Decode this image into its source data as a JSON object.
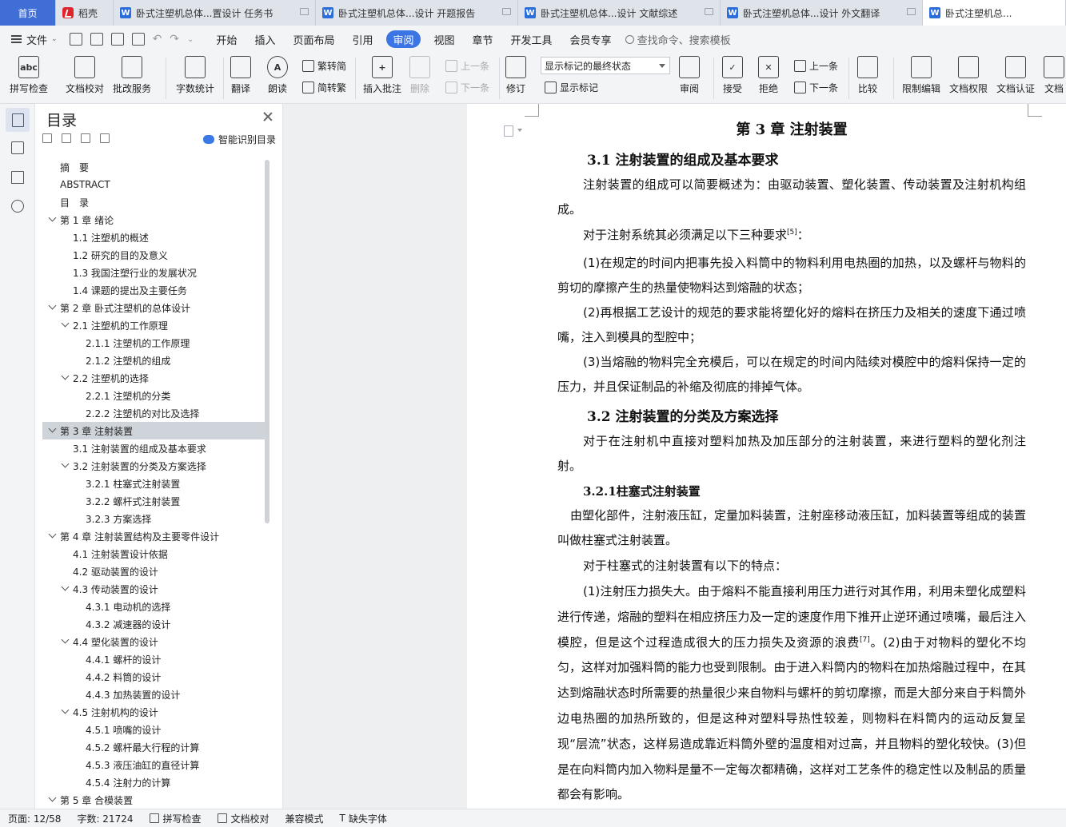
{
  "tabs": [
    {
      "label": "首页",
      "type": "home"
    },
    {
      "label": "稻壳",
      "type": "docer"
    },
    {
      "label": "卧式注塑机总体...置设计 任务书",
      "type": "doc"
    },
    {
      "label": "卧式注塑机总体...设计 开题报告",
      "type": "doc"
    },
    {
      "label": "卧式注塑机总体...设计 文献综述",
      "type": "doc"
    },
    {
      "label": "卧式注塑机总体...设计 外文翻译",
      "type": "doc"
    },
    {
      "label": "卧式注塑机总...",
      "type": "doc",
      "active": true
    }
  ],
  "menu": {
    "file": "文件",
    "items": [
      "开始",
      "插入",
      "页面布局",
      "引用",
      "审阅",
      "视图",
      "章节",
      "开发工具",
      "会员专享"
    ],
    "active": "审阅",
    "search_placeholder": "查找命令、搜索模板"
  },
  "ribbon": {
    "spell_check": "拼写检查",
    "doc_proof": "文档校对",
    "review_service": "批改服务",
    "word_count": "字数统计",
    "translate": "翻译",
    "read_aloud": "朗读",
    "trad_to_simp": "繁转简",
    "simp_to_trad": "简转繁",
    "insert_comment": "插入批注",
    "delete": "删除",
    "prev_comment": "上一条",
    "next_comment": "下一条",
    "track_changes": "修订",
    "markup_mode": "显示标记的最终状态",
    "show_markup": "显示标记",
    "review_pane": "审阅",
    "accept": "接受",
    "reject": "拒绝",
    "prev_change": "上一条",
    "next_change": "下一条",
    "compare": "比较",
    "restrict_edit": "限制编辑",
    "doc_rights": "文档权限",
    "doc_cert": "文档认证",
    "doc_more": "文档"
  },
  "toc": {
    "title": "目录",
    "smart_label": "智能识别目录",
    "items": [
      {
        "text": "摘　要",
        "level": 0,
        "chev": false
      },
      {
        "text": "ABSTRACT",
        "level": 0,
        "chev": false
      },
      {
        "text": "目　录",
        "level": 0,
        "chev": false
      },
      {
        "text": "第 1 章  绪论",
        "level": 0,
        "chev": true
      },
      {
        "text": "1.1  注塑机的概述",
        "level": 1,
        "chev": false
      },
      {
        "text": "1.2  研究的目的及意义",
        "level": 1,
        "chev": false
      },
      {
        "text": "1.3  我国注塑行业的发展状况",
        "level": 1,
        "chev": false
      },
      {
        "text": "1.4  课题的提出及主要任务",
        "level": 1,
        "chev": false
      },
      {
        "text": "第 2 章  卧式注塑机的总体设计",
        "level": 0,
        "chev": true
      },
      {
        "text": "2.1 注塑机的工作原理",
        "level": 1,
        "chev": true
      },
      {
        "text": "2.1.1 注塑机的工作原理",
        "level": 2,
        "chev": false
      },
      {
        "text": "2.1.2 注塑机的组成",
        "level": 2,
        "chev": false
      },
      {
        "text": "2.2  注塑机的选择",
        "level": 1,
        "chev": true
      },
      {
        "text": "2.2.1 注塑机的分类",
        "level": 2,
        "chev": false
      },
      {
        "text": "2.2.2 注塑机的对比及选择",
        "level": 2,
        "chev": false
      },
      {
        "text": "第 3 章  注射装置",
        "level": 0,
        "chev": true,
        "selected": true
      },
      {
        "text": "3.1  注射装置的组成及基本要求",
        "level": 1,
        "chev": false
      },
      {
        "text": "3.2  注射装置的分类及方案选择",
        "level": 1,
        "chev": true
      },
      {
        "text": "3.2.1 柱塞式注射装置",
        "level": 2,
        "chev": false
      },
      {
        "text": "3.2.2 螺杆式注射装置",
        "level": 2,
        "chev": false
      },
      {
        "text": "3.2.3  方案选择",
        "level": 2,
        "chev": false
      },
      {
        "text": "第 4 章  注射装置结构及主要零件设计",
        "level": 0,
        "chev": true
      },
      {
        "text": "4.1 注射装置设计依据",
        "level": 1,
        "chev": false
      },
      {
        "text": "4.2 驱动装置的设计",
        "level": 1,
        "chev": false
      },
      {
        "text": "4.3 传动装置的设计",
        "level": 1,
        "chev": true
      },
      {
        "text": "4.3.1 电动机的选择",
        "level": 2,
        "chev": false
      },
      {
        "text": "4.3.2 减速器的设计",
        "level": 2,
        "chev": false
      },
      {
        "text": "4.4 塑化装置的设计",
        "level": 1,
        "chev": true
      },
      {
        "text": "4.4.1  螺杆的设计",
        "level": 2,
        "chev": false
      },
      {
        "text": "4.4.2 料筒的设计",
        "level": 2,
        "chev": false
      },
      {
        "text": "4.4.3 加热装置的设计",
        "level": 2,
        "chev": false
      },
      {
        "text": "4.5 注射机构的设计",
        "level": 1,
        "chev": true
      },
      {
        "text": "4.5.1 喷嘴的设计",
        "level": 2,
        "chev": false
      },
      {
        "text": "4.5.2  螺杆最大行程的计算",
        "level": 2,
        "chev": false
      },
      {
        "text": "4.5.3 液压油缸的直径计算",
        "level": 2,
        "chev": false
      },
      {
        "text": "4.5.4 注射力的计算",
        "level": 2,
        "chev": false
      },
      {
        "text": "第 5 章  合模装置",
        "level": 0,
        "chev": true
      }
    ]
  },
  "document": {
    "chapter_title": "第 3 章  注射装置",
    "sec1_title": "3.1 注射装置的组成及基本要求",
    "p1": "注射装置的组成可以简要概述为：由驱动装置、塑化装置、传动装置及注射机构组成。",
    "p2": "对于注射系统其必须满足以下三种要求",
    "p2_ref": "[5]",
    "p2_end": "：",
    "p3": "(1)在规定的时间内把事先投入料筒中的物料利用电热圈的加热，以及螺杆与物料的剪切的摩擦产生的热量使物料达到熔融的状态；",
    "p4": "(2)再根据工艺设计的规范的要求能将塑化好的熔料在挤压力及相关的速度下通过喷嘴，注入到模具的型腔中；",
    "p5": "(3)当熔融的物料完全充模后，可以在规定的时间内陆续对模腔中的熔料保持一定的压力，并且保证制品的补缩及彻底的排掉气体。",
    "sec2_title": "3.2 注射装置的分类及方案选择",
    "p6": "对于在注射机中直接对塑料加热及加压部分的注射装置，来进行塑料的塑化剂注射。",
    "sub1_title": "3.2.1柱塞式注射装置",
    "p7": "由塑化部件，注射液压缸，定量加料装置，注射座移动液压缸，加料装置等组成的装置叫做柱塞式注射装置。",
    "p8": "对于柱塞式的注射装置有以下的特点：",
    "p9a": "(1)注射压力损失大。由于熔料不能直接利用压力进行对其作用，利用未塑化成塑料进行传递，熔融的塑料在相应挤压力及一定的速度作用下推开止逆环通过喷嘴，最后注入模腔，但是这个过程造成很大的压力损失及资源的浪费",
    "p9_ref": "[7]",
    "p9b": "。(2)由于对物料的塑化不均匀，这样对加强料筒的能力也受到限制。由于进入料筒内的物料在加热熔融过程中，在其达到熔融状态时所需要的热量很少来自物料与螺杆的剪切摩擦，而是大部分来自于料筒外边电热圈的加热所致的，但是这种对塑料导热性较差，则物料在料筒内的运动反复呈现“层流”状态，这样易造成靠近料筒外壁的温度相对过高，并且物料的塑化较快。(3)但是在向料筒内加入物料是量不一定每次都精确，这样对工艺条件的稳定性以及制品的质量都会有影响。"
  },
  "status": {
    "page": "页面: 12/58",
    "words": "字数: 21724",
    "spell": "拼写检查",
    "proof": "文档校对",
    "compat": "兼容模式",
    "missing_font": "缺失字体"
  }
}
